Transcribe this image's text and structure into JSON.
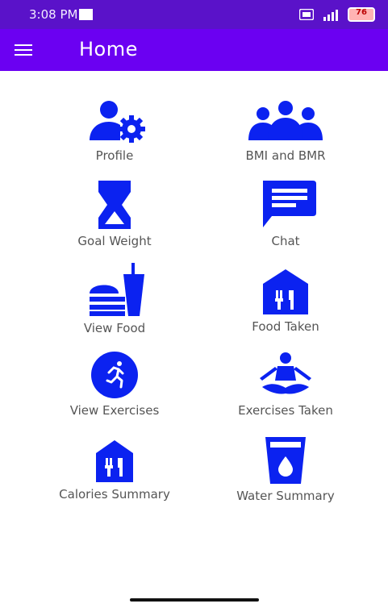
{
  "status_bar": {
    "time": "3:08 PM",
    "battery": "76"
  },
  "toolbar": {
    "title": "Home"
  },
  "tiles": [
    {
      "label": "Profile",
      "icon": "profile-settings-icon"
    },
    {
      "label": "BMI and BMR",
      "icon": "group-icon"
    },
    {
      "label": "Goal Weight",
      "icon": "hourglass-icon"
    },
    {
      "label": "Chat",
      "icon": "chat-icon"
    },
    {
      "label": "View Food",
      "icon": "fastfood-icon"
    },
    {
      "label": "Food Taken",
      "icon": "restaurant-house-icon"
    },
    {
      "label": "View Exercises",
      "icon": "running-icon"
    },
    {
      "label": "Exercises Taken",
      "icon": "meditation-icon"
    },
    {
      "label": "Calories Summary",
      "icon": "restaurant-house-icon"
    },
    {
      "label": "Water Summary",
      "icon": "water-glass-icon"
    }
  ],
  "colors": {
    "accent": "#0b22f0",
    "toolbar": "#6b00f2",
    "status_bar": "#5a12c9"
  }
}
